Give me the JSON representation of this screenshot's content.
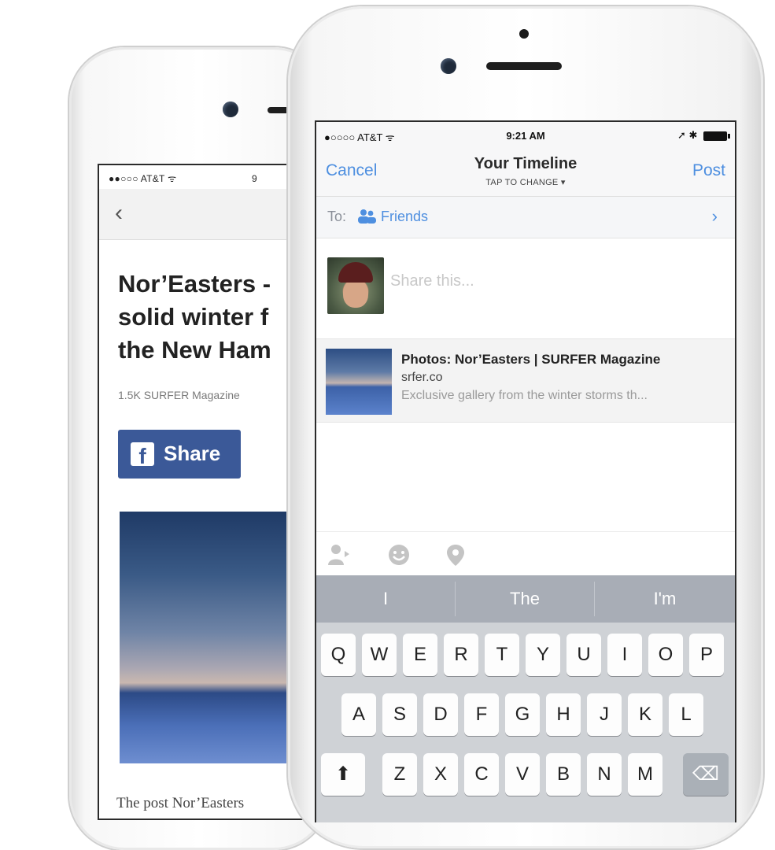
{
  "back_phone": {
    "status_carrier": "●●○○○ AT&T ᯤ",
    "status_clip": "9",
    "back_chevron": "‹",
    "article_title": "Nor’Easters -\nsolid winter f\nthe New Ham",
    "article_meta": "1.5K SURFER Magazine",
    "share_button": {
      "icon": "f",
      "label": "Share"
    },
    "photo_caption": "The post Nor’Easters"
  },
  "front_phone": {
    "status": {
      "carrier": "●○○○○ AT&T ᯤ",
      "time": "9:21 AM",
      "right_icons": "➚ ✱"
    },
    "nav": {
      "cancel": "Cancel",
      "title": "Your Timeline",
      "subtitle": "TAP TO CHANGE ▾",
      "post": "Post"
    },
    "audience": {
      "label": "To:",
      "value": "Friends",
      "chevron": "›"
    },
    "composer": {
      "placeholder": "Share this..."
    },
    "link_preview": {
      "title": "Photos: Nor’Easters | SURFER Magazine",
      "domain": "srfer.co",
      "description": "Exclusive gallery from the winter storms th..."
    },
    "toolbar_icons": [
      "tag-people-icon",
      "emoji-icon",
      "location-pin-icon"
    ],
    "suggestions": [
      "I",
      "The",
      "I'm"
    ],
    "keyboard": {
      "row1": [
        "Q",
        "W",
        "E",
        "R",
        "T",
        "Y",
        "U",
        "I",
        "O",
        "P"
      ],
      "row2": [
        "A",
        "S",
        "D",
        "F",
        "G",
        "H",
        "J",
        "K",
        "L"
      ],
      "row3": [
        "Z",
        "X",
        "C",
        "V",
        "B",
        "N",
        "M"
      ],
      "shift": "⬆",
      "delete": "⌫"
    }
  },
  "colors": {
    "facebook_blue": "#3b5998",
    "ios_blue": "#4e8fe0",
    "keyboard_bg": "#cfd2d6",
    "suggest_bg": "#a8adb6"
  }
}
